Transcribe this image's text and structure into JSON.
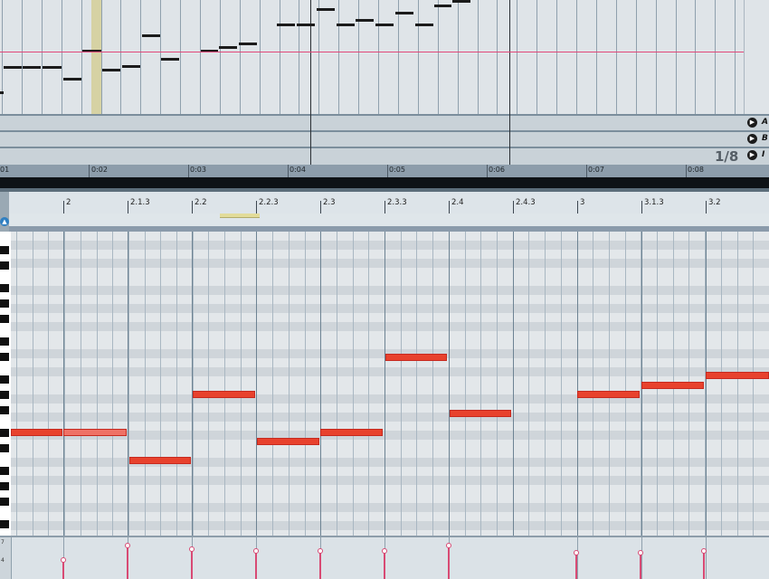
{
  "arrangement": {
    "ruler_labels": [
      "01",
      "0:02",
      "0:03",
      "0:04",
      "0:05",
      "0:06",
      "0:07",
      "0:08"
    ],
    "grid_value": "1/8",
    "lanes": [
      {
        "letter": "A",
        "button_icon": "play-triangle-icon"
      },
      {
        "letter": "B",
        "button_icon": "play-triangle-icon"
      },
      {
        "letter": "I",
        "button_icon": "play-triangle-icon"
      }
    ]
  },
  "clip_editor": {
    "ruler_labels": [
      "2",
      "2.1.3",
      "2.2",
      "2.2.3",
      "2.3",
      "2.3.3",
      "2.4",
      "2.4.3",
      "3",
      "3.1.3",
      "3.2"
    ],
    "velocity_scale": [
      "7",
      "4"
    ],
    "fold_icon": "fold-icon"
  },
  "colors": {
    "note": "#e8422d",
    "note_selected": "#ef7266",
    "velocity": "#d84a74",
    "loop": "#e2dc9a"
  }
}
